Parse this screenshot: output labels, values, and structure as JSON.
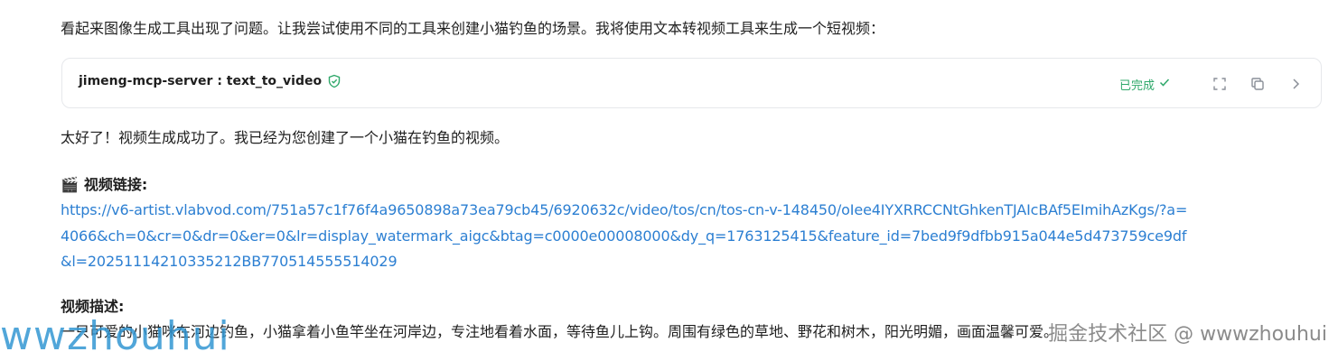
{
  "intro_text": "看起来图像生成工具出现了问题。让我尝试使用不同的工具来创建小猫钓鱼的场景。我将使用文本转视频工具来生成一个短视频：",
  "tool_call": {
    "name": "jimeng-mcp-server : text_to_video",
    "status": "已完成",
    "icons": [
      "shield-check-icon",
      "checkmark-icon",
      "expand-icon",
      "copy-icon",
      "chevron-right-icon"
    ]
  },
  "reply_text": "太好了！视频生成成功了。我已经为您创建了一个小猫在钓鱼的视频。",
  "video_section": {
    "emoji": "🎬",
    "title": "视频链接:",
    "link": "https://v6-artist.vlabvod.com/751a57c1f76f4a9650898a73ea79cb45/6920632c/video/tos/cn/tos-cn-v-148450/oIee4IYXRRCCNtGhkenTJAIcBAf5EImihAzKgs/?a=4066&ch=0&cr=0&dr=0&er=0&lr=display_watermark_aigc&btag=c0000e00008000&dy_q=1763125415&feature_id=7bed9f9dfbb915a044e5d473759ce9df&l=20251114210335212BB770514555514029"
  },
  "description_section": {
    "title": "视频描述:",
    "text": "一只可爱的小猫咪在河边钓鱼，小猫拿着小鱼竿坐在河岸边，专注地看着水面，等待鱼儿上钩。周围有绿色的草地、野花和树木，阳光明媚，画面温馨可爱。"
  },
  "watermarks": {
    "left": "wwzhouhui",
    "right": "掘金技术社区 @ wwwzhouhui"
  },
  "colors": {
    "link": "#2c7fd2",
    "status": "#2fa86a",
    "watermark": "#3296d2"
  }
}
